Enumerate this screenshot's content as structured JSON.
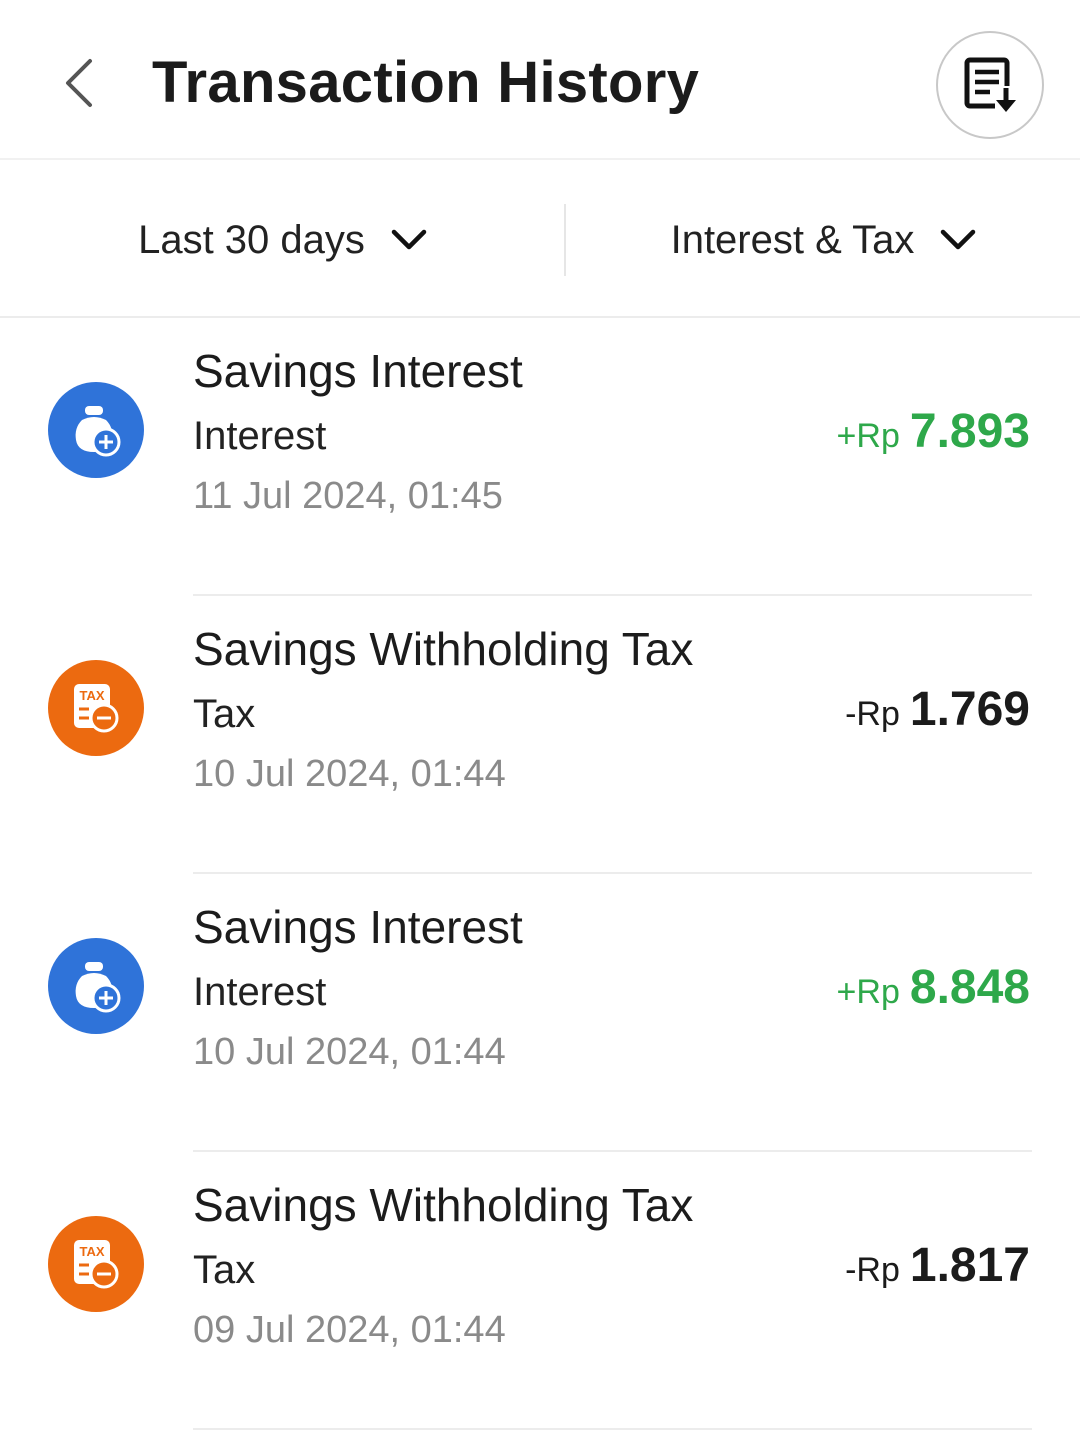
{
  "header": {
    "title": "Transaction History",
    "back_icon": "chevron-left-icon",
    "download_icon": "document-download-icon"
  },
  "filters": {
    "period": "Last 30 days",
    "type": "Interest & Tax"
  },
  "colors": {
    "credit": "#2ea84a",
    "interest_icon_bg": "#2f73d9",
    "tax_icon_bg": "#ec6a10"
  },
  "transactions": [
    {
      "name": "Savings Interest",
      "category": "Interest",
      "date": "11 Jul 2024, 01:45",
      "prefix": "+Rp",
      "amount": "7.893",
      "direction": "credit",
      "icon": "money-bag-plus-icon"
    },
    {
      "name": "Savings Withholding Tax",
      "category": "Tax",
      "date": "10 Jul 2024, 01:44",
      "prefix": "-Rp",
      "amount": "1.769",
      "direction": "debit",
      "icon": "tax-minus-icon",
      "icon_text": "TAX"
    },
    {
      "name": "Savings Interest",
      "category": "Interest",
      "date": "10 Jul 2024, 01:44",
      "prefix": "+Rp",
      "amount": "8.848",
      "direction": "credit",
      "icon": "money-bag-plus-icon"
    },
    {
      "name": "Savings Withholding Tax",
      "category": "Tax",
      "date": "09 Jul 2024, 01:44",
      "prefix": "-Rp",
      "amount": "1.817",
      "direction": "debit",
      "icon": "tax-minus-icon",
      "icon_text": "TAX"
    }
  ]
}
